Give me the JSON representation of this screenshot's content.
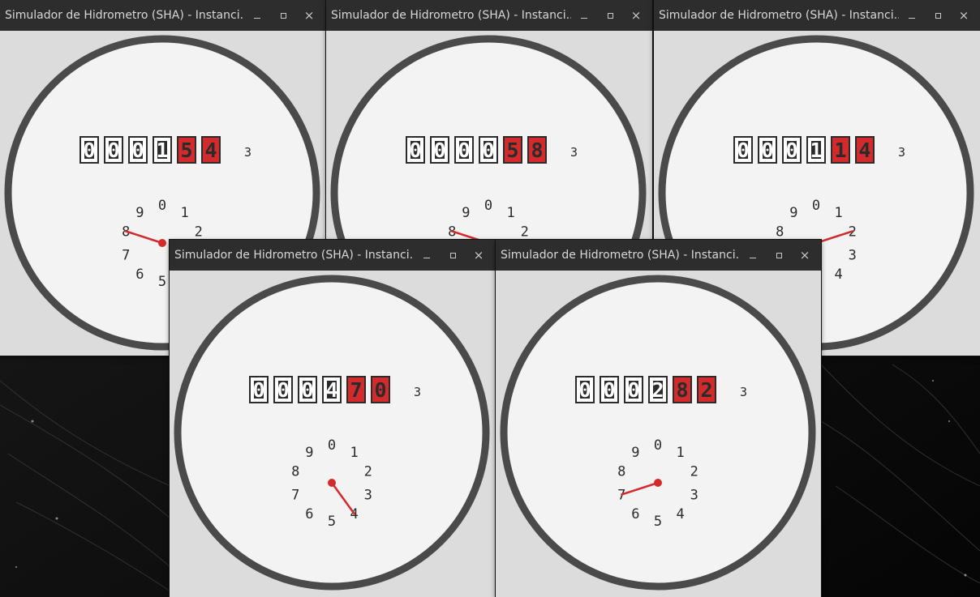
{
  "window_title": "Simulador de Hidrometro (SHA) - Instanci...",
  "controls": {
    "close": "×"
  },
  "unit_label": "3",
  "dial_numbers": [
    "0",
    "1",
    "2",
    "3",
    "4",
    "5",
    "6",
    "7",
    "8",
    "9"
  ],
  "colors": {
    "ring": "#4a4a4a",
    "face": "#f3f3f3",
    "red": "#d32b2b",
    "dark": "#2b2b2b",
    "titlebar": "#2d2d2d"
  },
  "meters": [
    {
      "id": "w1",
      "digits": [
        "0",
        "0",
        "0",
        "1",
        "5",
        "4"
      ],
      "needle_value": 8.0
    },
    {
      "id": "w2",
      "digits": [
        "0",
        "0",
        "0",
        "0",
        "5",
        "8"
      ],
      "needle_value": 8.0
    },
    {
      "id": "w3",
      "digits": [
        "0",
        "0",
        "0",
        "1",
        "1",
        "4"
      ],
      "needle_value": 2.0
    },
    {
      "id": "w4",
      "digits": [
        "0",
        "0",
        "0",
        "4",
        "7",
        "0"
      ],
      "needle_value": 4.0
    },
    {
      "id": "w5",
      "digits": [
        "0",
        "0",
        "0",
        "2",
        "8",
        "2"
      ],
      "needle_value": 7.0
    }
  ]
}
